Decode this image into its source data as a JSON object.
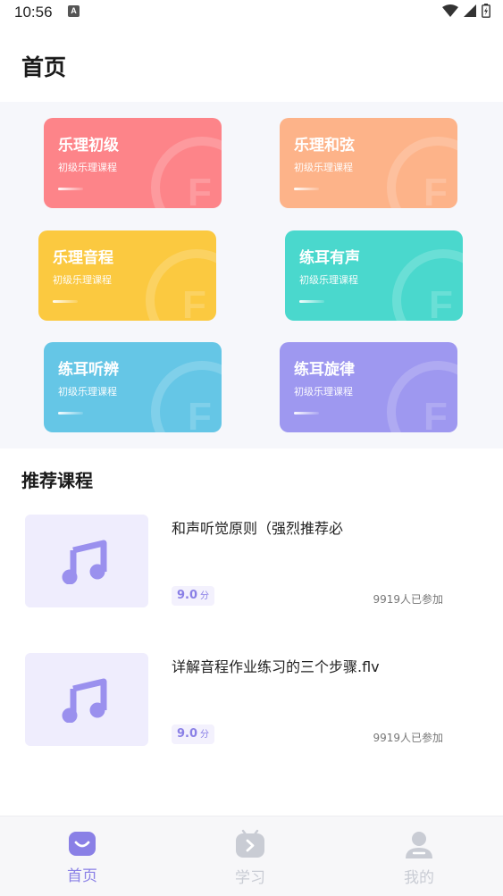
{
  "status_bar": {
    "time": "10:56",
    "notification_letter": "A"
  },
  "header": {
    "title": "首页"
  },
  "categories": [
    {
      "title": "乐理初级",
      "subtitle": "初级乐理课程",
      "color": "#fd8489"
    },
    {
      "title": "乐理和弦",
      "subtitle": "初级乐理课程",
      "color": "#fdb389"
    },
    {
      "title": "乐理音程",
      "subtitle": "初级乐理课程",
      "color": "#fbc940"
    },
    {
      "title": "练耳有声",
      "subtitle": "初级乐理课程",
      "color": "#4ad8cd"
    },
    {
      "title": "练耳听辨",
      "subtitle": "初级乐理课程",
      "color": "#65c6e6"
    },
    {
      "title": "练耳旋律",
      "subtitle": "初级乐理课程",
      "color": "#9e98f0"
    }
  ],
  "recommended": {
    "title": "推荐课程",
    "courses": [
      {
        "title": "和声听觉原则（强烈推荐必",
        "score": "9.0",
        "score_unit": "分",
        "participants": "9919人已参加"
      },
      {
        "title": "详解音程作业练习的三个步骤.flv",
        "score": "9.0",
        "score_unit": "分",
        "participants": "9919人已参加"
      }
    ]
  },
  "bottom_nav": {
    "items": [
      {
        "label": "首页",
        "icon": "home-smile-icon",
        "active": true
      },
      {
        "label": "学习",
        "icon": "study-play-icon",
        "active": false
      },
      {
        "label": "我的",
        "icon": "profile-icon",
        "active": false
      }
    ],
    "active_color": "#8a80e6",
    "inactive_color": "#c9ccd4"
  }
}
